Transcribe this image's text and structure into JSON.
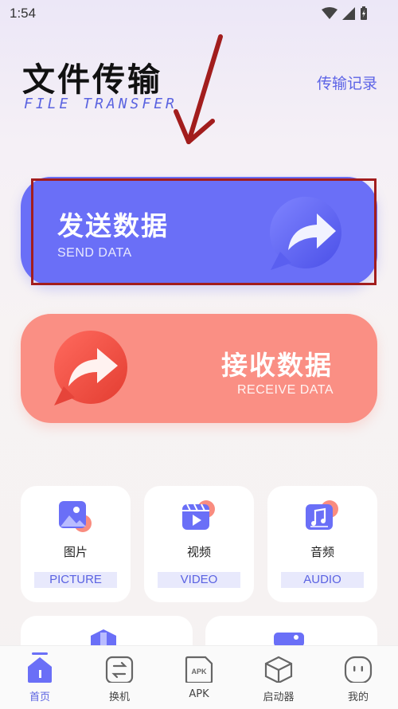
{
  "status_bar": {
    "time": "1:54"
  },
  "header": {
    "title_cn": "文件传输",
    "title_en": "FILE TRANSFER",
    "history_link": "传输记录"
  },
  "send": {
    "title": "发送数据",
    "subtitle": "SEND DATA"
  },
  "receive": {
    "title": "接收数据",
    "subtitle": "RECEIVE DATA"
  },
  "categories": [
    {
      "label_cn": "图片",
      "label_en": "PICTURE",
      "icon": "picture-icon"
    },
    {
      "label_cn": "视频",
      "label_en": "VIDEO",
      "icon": "video-icon"
    },
    {
      "label_cn": "音频",
      "label_en": "AUDIO",
      "icon": "audio-icon"
    }
  ],
  "bottom_nav": [
    {
      "label": "首页",
      "icon": "home-icon",
      "active": true
    },
    {
      "label": "换机",
      "icon": "swap-icon",
      "active": false
    },
    {
      "label": "APK",
      "icon": "apk-icon",
      "active": false
    },
    {
      "label": "启动器",
      "icon": "launcher-box-icon",
      "active": false
    },
    {
      "label": "我的",
      "icon": "profile-face-icon",
      "active": false
    }
  ],
  "colors": {
    "accent": "#6a6ff7",
    "receive": "#fa8f84",
    "annotation": "#a21d1d"
  }
}
